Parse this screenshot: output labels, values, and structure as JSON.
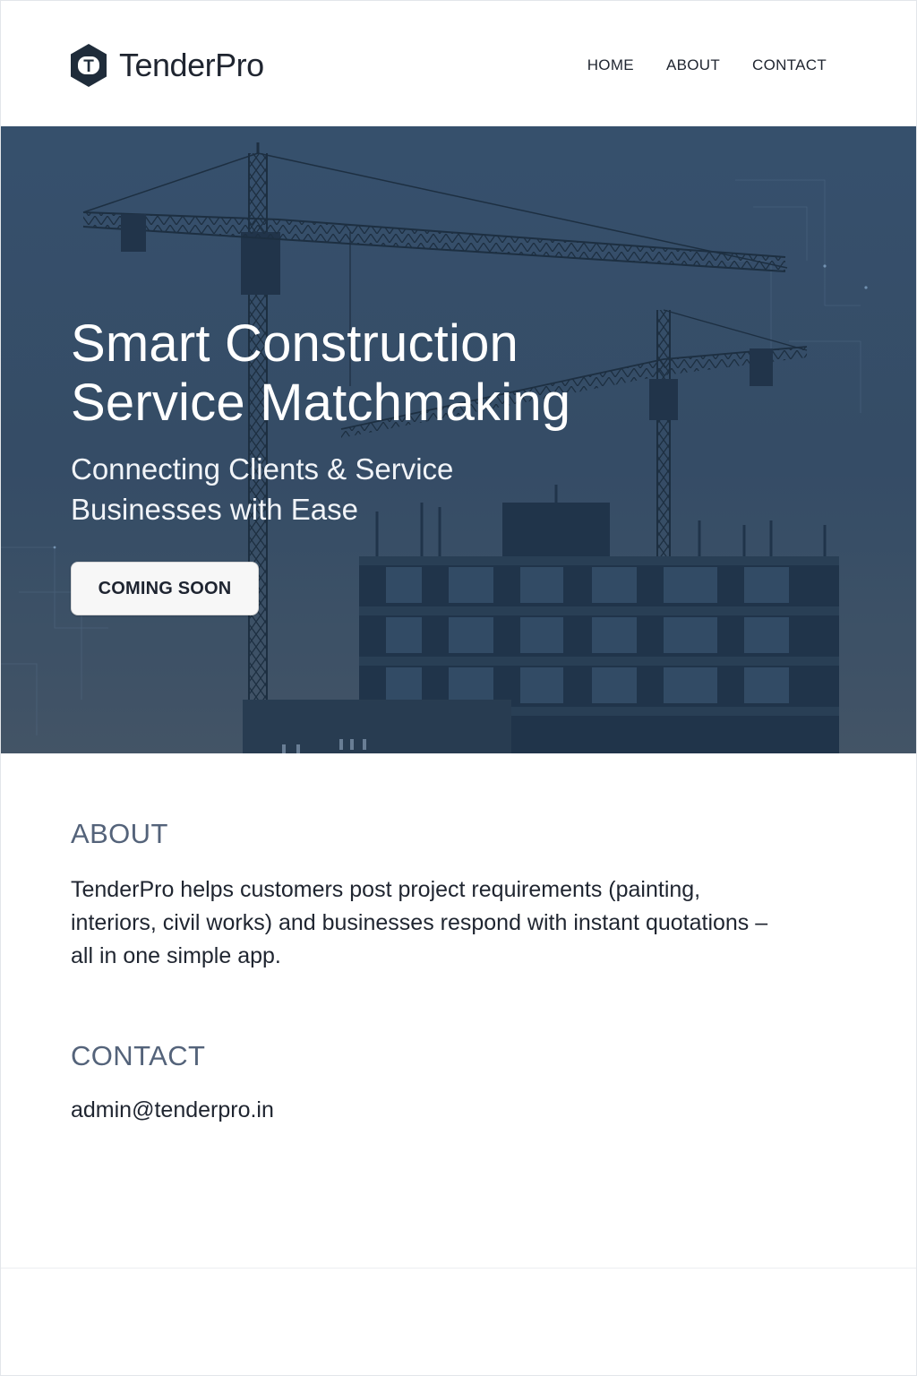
{
  "header": {
    "brand_name": "TenderPro",
    "logo_letter": "T",
    "logo_icon": "hexagon-t-logo",
    "nav": [
      {
        "label": "HOME"
      },
      {
        "label": "ABOUT"
      },
      {
        "label": "CONTACT"
      }
    ]
  },
  "hero": {
    "title": "Smart Construction Service Matchmaking",
    "subtitle": "Connecting Clients & Service Businesses with Ease",
    "cta_label": "COMING SOON"
  },
  "about": {
    "heading": "ABOUT",
    "body": "TenderPro helps customers post project requirements (painting, interiors, civil works) and businesses respond with instant quotations – all in one simple app."
  },
  "contact": {
    "heading": "CONTACT",
    "email": "admin@tenderpro.in"
  },
  "colors": {
    "brand_dark": "#1f2530",
    "hero_overlay": "#36506a",
    "section_heading": "#54637a"
  }
}
